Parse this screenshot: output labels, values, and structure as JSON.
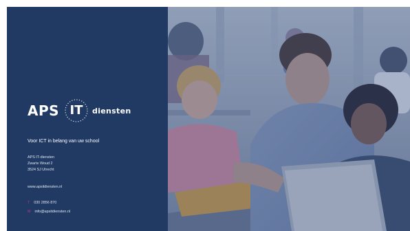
{
  "brand": {
    "name_main": "APS",
    "name_badge": "IT",
    "name_suffix": "diensten"
  },
  "tagline": "Voor ICT in belang van uw school",
  "address": {
    "company": "APS IT-diensten",
    "street": "Zwarte Woud 2",
    "city": "3524 SJ Utrecht"
  },
  "website": "www.apsitdiensten.nl",
  "contact": {
    "phone_label": "T",
    "phone": "030 2856 870",
    "email_label": "M",
    "email": "info@apsitdiensten.nl"
  },
  "colors": {
    "panel": "#213a63",
    "accent": "#c2338a",
    "text": "#ffffff"
  }
}
